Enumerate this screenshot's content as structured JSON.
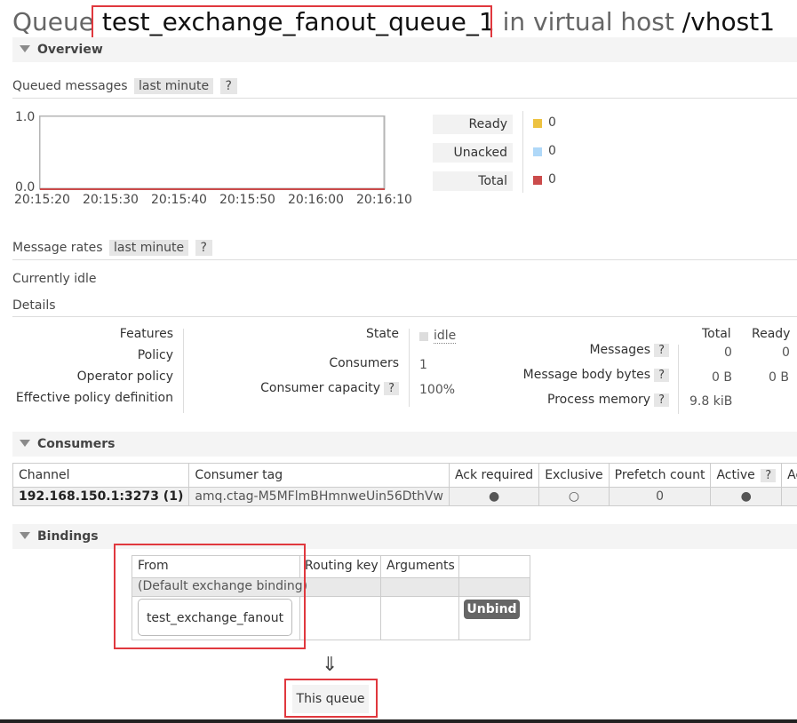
{
  "header": {
    "prefix": "Queue",
    "queue_name": "test_exchange_fanout_queue_1",
    "mid": "in virtual host",
    "vhost": "/vhost1"
  },
  "overview": {
    "section_title": "Overview",
    "queued_messages_label": "Queued messages",
    "queued_period": "last minute",
    "help": "?",
    "chart_data": {
      "type": "line",
      "x": [
        "20:15:20",
        "20:15:30",
        "20:15:40",
        "20:15:50",
        "20:16:00",
        "20:16:10"
      ],
      "ylim": [
        0.0,
        1.0
      ],
      "yticks": [
        "1.0",
        "0.0"
      ],
      "series": [
        {
          "name": "Ready",
          "values": [
            0,
            0,
            0,
            0,
            0,
            0
          ],
          "color": "#edc240"
        },
        {
          "name": "Unacked",
          "values": [
            0,
            0,
            0,
            0,
            0,
            0
          ],
          "color": "#afd8f8"
        },
        {
          "name": "Total",
          "values": [
            0,
            0,
            0,
            0,
            0,
            0
          ],
          "color": "#cb4b4b"
        }
      ]
    },
    "legend": [
      {
        "label": "Ready",
        "value": "0",
        "color": "#edc240"
      },
      {
        "label": "Unacked",
        "value": "0",
        "color": "#afd8f8"
      },
      {
        "label": "Total",
        "value": "0",
        "color": "#cb4b4b"
      }
    ],
    "message_rates_label": "Message rates",
    "rates_period": "last minute",
    "idle_text": "Currently idle",
    "details_label": "Details"
  },
  "details": {
    "features_label": "Features",
    "policy_label": "Policy",
    "operator_policy_label": "Operator policy",
    "effective_policy_label": "Effective policy definition",
    "state_label": "State",
    "state_value": "idle",
    "consumers_label": "Consumers",
    "consumers_value": "1",
    "consumer_capacity_label": "Consumer capacity",
    "consumer_capacity_value": "100%",
    "col_total": "Total",
    "col_ready": "Ready",
    "messages_label": "Messages",
    "messages_total": "0",
    "messages_ready": "0",
    "body_bytes_label": "Message body bytes",
    "body_bytes_total": "0 B",
    "body_bytes_ready": "0 B",
    "process_memory_label": "Process memory",
    "process_memory_value": "9.8 kiB"
  },
  "consumers": {
    "section_title": "Consumers",
    "headers": [
      "Channel",
      "Consumer tag",
      "Ack required",
      "Exclusive",
      "Prefetch count",
      "Active",
      "?",
      "Activ"
    ],
    "row": {
      "channel": "192.168.150.1:3273 (1)",
      "tag": "amq.ctag-M5MFlmBHmnweUin56DthVw",
      "ack_required": "●",
      "exclusive": "○",
      "prefetch": "0",
      "active": "●"
    }
  },
  "bindings": {
    "section_title": "Bindings",
    "headers": [
      "From",
      "Routing key",
      "Arguments"
    ],
    "default_binding": "(Default exchange binding)",
    "exchange": "test_exchange_fanout",
    "unbind_label": "Unbind",
    "arrow": "⇓",
    "this_queue": "This queue"
  }
}
